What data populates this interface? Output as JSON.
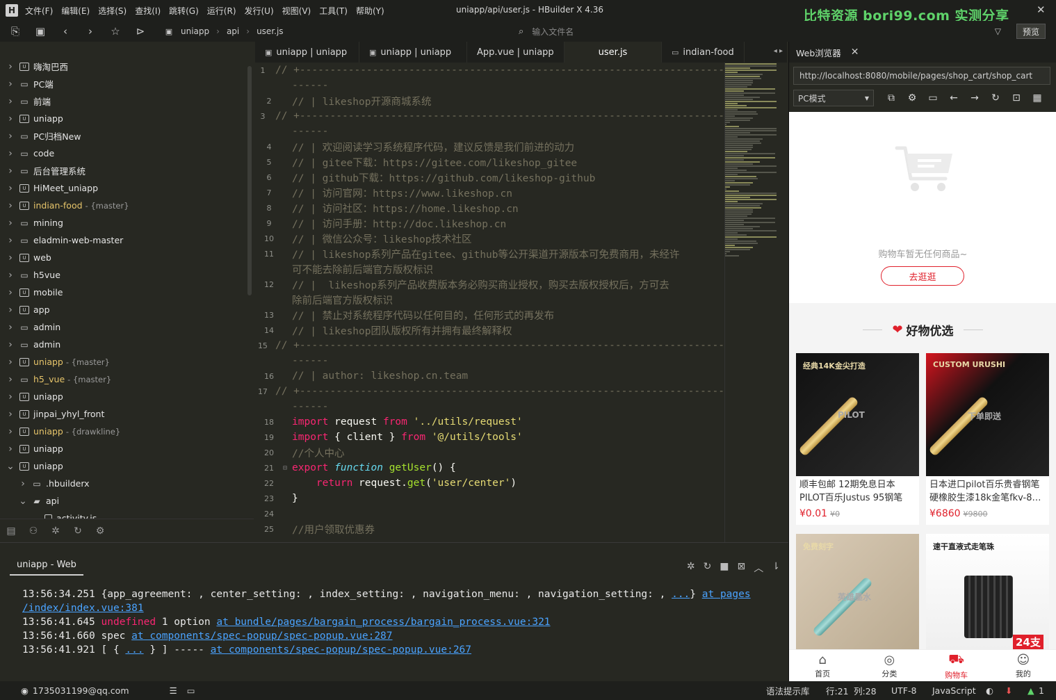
{
  "app": {
    "title": "uniapp/api/user.js - HBuilder X 4.36",
    "logo": "H",
    "watermark": "比特资源 bori99.com 实测分享",
    "menu": [
      "文件(F)",
      "编辑(E)",
      "选择(S)",
      "查找(I)",
      "跳转(G)",
      "运行(R)",
      "发行(U)",
      "视图(V)",
      "工具(T)",
      "帮助(Y)"
    ]
  },
  "toolbar": {
    "breadcrumb": [
      "uniapp",
      "api",
      "user.js"
    ],
    "file_search_placeholder": "输入文件名",
    "preview_label": "预览"
  },
  "sidebar": {
    "items": [
      {
        "label": "嗨淘巴西",
        "icon": "u",
        "branch": "",
        "gold": false,
        "open": false,
        "indent": 0
      },
      {
        "label": "PC端",
        "icon": "folder",
        "branch": "",
        "gold": false,
        "open": false,
        "indent": 0
      },
      {
        "label": "前端",
        "icon": "folder",
        "branch": "",
        "gold": false,
        "open": false,
        "indent": 0
      },
      {
        "label": "uniapp",
        "icon": "u",
        "branch": "",
        "gold": false,
        "open": false,
        "indent": 0
      },
      {
        "label": "PC归档New",
        "icon": "folder",
        "branch": "",
        "gold": false,
        "open": false,
        "indent": 0
      },
      {
        "label": "code",
        "icon": "folder",
        "branch": "",
        "gold": false,
        "open": false,
        "indent": 0
      },
      {
        "label": "后台管理系统",
        "icon": "folder",
        "branch": "",
        "gold": false,
        "open": false,
        "indent": 0
      },
      {
        "label": "HiMeet_uniapp",
        "icon": "u",
        "branch": "",
        "gold": false,
        "open": false,
        "indent": 0
      },
      {
        "label": "indian-food",
        "icon": "u",
        "branch": "- {master}",
        "gold": true,
        "open": false,
        "indent": 0
      },
      {
        "label": "mining",
        "icon": "folder",
        "branch": "",
        "gold": false,
        "open": false,
        "indent": 0
      },
      {
        "label": "eladmin-web-master",
        "icon": "folder",
        "branch": "",
        "gold": false,
        "open": false,
        "indent": 0
      },
      {
        "label": "web",
        "icon": "u",
        "branch": "",
        "gold": false,
        "open": false,
        "indent": 0
      },
      {
        "label": "h5vue",
        "icon": "folder",
        "branch": "",
        "gold": false,
        "open": false,
        "indent": 0
      },
      {
        "label": "mobile",
        "icon": "u",
        "branch": "",
        "gold": false,
        "open": false,
        "indent": 0
      },
      {
        "label": "app",
        "icon": "u",
        "branch": "",
        "gold": false,
        "open": false,
        "indent": 0
      },
      {
        "label": "admin",
        "icon": "folder",
        "branch": "",
        "gold": false,
        "open": false,
        "indent": 0
      },
      {
        "label": "admin",
        "icon": "folder",
        "branch": "",
        "gold": false,
        "open": false,
        "indent": 0
      },
      {
        "label": "uniapp",
        "icon": "u",
        "branch": "- {master}",
        "gold": true,
        "open": false,
        "indent": 0
      },
      {
        "label": "h5_vue",
        "icon": "folder",
        "branch": "- {master}",
        "gold": true,
        "open": false,
        "indent": 0
      },
      {
        "label": "uniapp",
        "icon": "u",
        "branch": "",
        "gold": false,
        "open": false,
        "indent": 0
      },
      {
        "label": "jinpai_yhyl_front",
        "icon": "u",
        "branch": "",
        "gold": false,
        "open": false,
        "indent": 0
      },
      {
        "label": "uniapp",
        "icon": "u",
        "branch": "- {drawkline}",
        "gold": true,
        "open": false,
        "indent": 0
      },
      {
        "label": "uniapp",
        "icon": "u",
        "branch": "",
        "gold": false,
        "open": false,
        "indent": 0
      },
      {
        "label": "uniapp",
        "icon": "u",
        "branch": "",
        "gold": false,
        "open": true,
        "indent": 0
      },
      {
        "label": ".hbuilderx",
        "icon": "folder",
        "branch": "",
        "gold": false,
        "open": false,
        "indent": 1
      },
      {
        "label": "api",
        "icon": "folder",
        "branch": "",
        "gold": false,
        "open": true,
        "indent": 1
      },
      {
        "label": "activity.js",
        "icon": "file",
        "branch": "",
        "gold": false,
        "open": false,
        "indent": 2
      }
    ]
  },
  "tabs": [
    "uniapp | uniapp",
    "uniapp | uniapp",
    "App.vue | uniapp",
    "user.js",
    "indian-food"
  ],
  "editor": {
    "lines": [
      {
        "n": "1",
        "t": [
          [
            "cm",
            "// +----------------------------------------------------------------------"
          ]
        ]
      },
      {
        "n": "",
        "t": [
          [
            "cm",
            "------"
          ]
        ]
      },
      {
        "n": "2",
        "t": [
          [
            "cm",
            "// | likeshop开源商城系统"
          ]
        ]
      },
      {
        "n": "3",
        "t": [
          [
            "cm",
            "// +----------------------------------------------------------------------"
          ]
        ]
      },
      {
        "n": "",
        "t": [
          [
            "cm",
            "------"
          ]
        ]
      },
      {
        "n": "4",
        "t": [
          [
            "cm",
            "// | 欢迎阅读学习系统程序代码，建议反馈是我们前进的动力"
          ]
        ]
      },
      {
        "n": "5",
        "t": [
          [
            "cm",
            "// | gitee下载：https://gitee.com/likeshop_gitee"
          ]
        ]
      },
      {
        "n": "6",
        "t": [
          [
            "cm",
            "// | github下载：https://github.com/likeshop-github"
          ]
        ]
      },
      {
        "n": "7",
        "t": [
          [
            "cm",
            "// | 访问官网：https://www.likeshop.cn"
          ]
        ]
      },
      {
        "n": "8",
        "t": [
          [
            "cm",
            "// | 访问社区：https://home.likeshop.cn"
          ]
        ]
      },
      {
        "n": "9",
        "t": [
          [
            "cm",
            "// | 访问手册：http://doc.likeshop.cn"
          ]
        ]
      },
      {
        "n": "10",
        "t": [
          [
            "cm",
            "// | 微信公众号：likeshop技术社区"
          ]
        ]
      },
      {
        "n": "11",
        "t": [
          [
            "cm",
            "// | likeshop系列产品在gitee、github等公开渠道开源版本可免费商用，未经许"
          ]
        ]
      },
      {
        "n": "",
        "t": [
          [
            "cm",
            "可不能去除前后端官方版权标识"
          ]
        ]
      },
      {
        "n": "12",
        "t": [
          [
            "cm",
            "// |  likeshop系列产品收费版本务必购买商业授权，购买去版权授权后，方可去"
          ]
        ]
      },
      {
        "n": "",
        "t": [
          [
            "cm",
            "除前后端官方版权标识"
          ]
        ]
      },
      {
        "n": "13",
        "t": [
          [
            "cm",
            "// | 禁止对系统程序代码以任何目的，任何形式的再发布"
          ]
        ]
      },
      {
        "n": "14",
        "t": [
          [
            "cm",
            "// | likeshop团队版权所有并拥有最终解释权"
          ]
        ]
      },
      {
        "n": "15",
        "t": [
          [
            "cm",
            "// +----------------------------------------------------------------------"
          ]
        ]
      },
      {
        "n": "",
        "t": [
          [
            "cm",
            "------"
          ]
        ]
      },
      {
        "n": "16",
        "t": [
          [
            "cm",
            "// | author: likeshop.cn.team"
          ]
        ]
      },
      {
        "n": "17",
        "t": [
          [
            "cm",
            "// +----------------------------------------------------------------------"
          ]
        ]
      },
      {
        "n": "",
        "t": [
          [
            "cm",
            "------"
          ]
        ]
      },
      {
        "n": "18",
        "t": [
          [
            "kw",
            "import"
          ],
          [
            "pl",
            " request "
          ],
          [
            "kw",
            "from"
          ],
          [
            "pl",
            " "
          ],
          [
            "st",
            "'../utils/request'"
          ]
        ]
      },
      {
        "n": "19",
        "t": [
          [
            "kw",
            "import"
          ],
          [
            "pl",
            " { client } "
          ],
          [
            "kw",
            "from"
          ],
          [
            "pl",
            " "
          ],
          [
            "st",
            "'@/utils/tools'"
          ]
        ]
      },
      {
        "n": "20",
        "t": [
          [
            "cm",
            "//个人中心"
          ]
        ]
      },
      {
        "n": "21",
        "f": "⊟",
        "t": [
          [
            "kw",
            "export"
          ],
          [
            "pl",
            " "
          ],
          [
            "it",
            "function"
          ],
          [
            "pl",
            " "
          ],
          [
            "fn",
            "getUser"
          ],
          [
            "pl",
            "() {"
          ]
        ]
      },
      {
        "n": "22",
        "t": [
          [
            "pl",
            "    "
          ],
          [
            "kw",
            "return"
          ],
          [
            "pl",
            " request."
          ],
          [
            "fn",
            "get"
          ],
          [
            "pl",
            "("
          ],
          [
            "st",
            "'user/center'"
          ],
          [
            "pl",
            ")"
          ]
        ]
      },
      {
        "n": "23",
        "t": [
          [
            "pl",
            "}"
          ]
        ]
      },
      {
        "n": "24",
        "t": [
          [
            "pl",
            ""
          ]
        ]
      },
      {
        "n": "25",
        "t": [
          [
            "cm",
            "//用户领取优惠券"
          ]
        ]
      }
    ]
  },
  "browser": {
    "tab_label": "Web浏览器",
    "url": "http://localhost:8080/mobile/pages/shop_cart/shop_cart",
    "mode": "PC模式",
    "empty_text": "购物车暂无任何商品~",
    "go_button": "去逛逛",
    "rec_title": "好物优选",
    "goods": [
      {
        "name": "顺丰包邮 12期免息日本PILOT百乐Justus 95钢笔14…",
        "price": "¥0.01",
        "orig": "¥0",
        "img_text": "经典14K金尖打造",
        "img_sub": "PILOT"
      },
      {
        "name": "日本进口pilot百乐贵睿钢笔硬橡胶生漆18k金笔fkv-8…",
        "price": "¥6860",
        "orig": "¥9800",
        "img_text": "CUSTOM URUSHI",
        "img_sub": "下单即送"
      },
      {
        "name": "",
        "price": "",
        "orig": "",
        "img_text": "免费刻字",
        "img_sub": "英雄墨水"
      },
      {
        "name": "",
        "price": "",
        "orig": "",
        "img_text": "速干直液式走笔珠",
        "img_sub": "24支"
      }
    ],
    "tabbar": [
      {
        "label": "首页",
        "icon": "⌂",
        "active": false
      },
      {
        "label": "分类",
        "icon": "◎",
        "active": false
      },
      {
        "label": "购物车",
        "icon": "⛟",
        "active": true
      },
      {
        "label": "我的",
        "icon": "☺",
        "active": false
      }
    ]
  },
  "console": {
    "tab": "uniapp - Web",
    "lines": [
      [
        [
          "t",
          "13:56:34.251 {app_agreement: , center_setting: , index_setting: , navigation_menu: , navigation_setting: , "
        ],
        [
          "l",
          "..."
        ],
        [
          "t",
          "} "
        ],
        [
          "l",
          "at pages"
        ]
      ],
      [
        [
          "l",
          "/index/index.vue:381"
        ]
      ],
      [
        [
          "t",
          "13:56:41.645 "
        ],
        [
          "u",
          "undefined"
        ],
        [
          "t",
          " 1 option "
        ],
        [
          "l",
          "at bundle/pages/bargain_process/bargain_process.vue:321"
        ]
      ],
      [
        [
          "t",
          "13:56:41.660 spec "
        ],
        [
          "l",
          "at components/spec-popup/spec-popup.vue:287"
        ]
      ],
      [
        [
          "t",
          "13:56:41.921 [ { "
        ],
        [
          "l",
          "..."
        ],
        [
          "t",
          " } ] ----- "
        ],
        [
          "l",
          "at components/spec-popup/spec-popup.vue:267"
        ]
      ]
    ]
  },
  "status": {
    "user": "1735031199@qq.com",
    "hint": "语法提示库",
    "row": "行:21",
    "col": "列:28",
    "encoding": "UTF-8",
    "language": "JavaScript",
    "notify": "1"
  }
}
